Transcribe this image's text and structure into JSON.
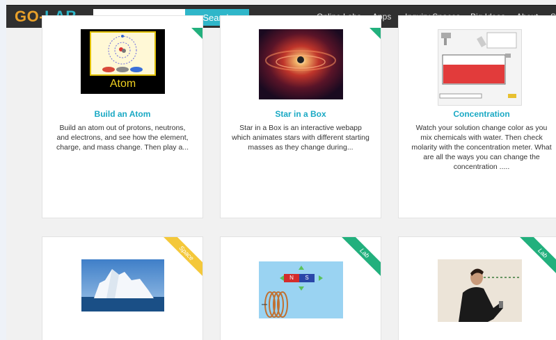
{
  "brand": {
    "go": "GO-",
    "lab": "LAB"
  },
  "search": {
    "placeholder": "",
    "button_label": "Search"
  },
  "nav": {
    "items": [
      "Online Labs",
      "Apps",
      "Inquiry Spaces",
      "Big Ideas",
      "About",
      "S"
    ]
  },
  "cards": [
    {
      "title": "Build an Atom",
      "description": "Build an atom out of protons, neutrons, and electrons, and see how the element, charge, and mass change. Then play a...",
      "thumb_label": "Atom"
    },
    {
      "title": "Star in a Box",
      "description": "Star in a Box is an interactive webapp which animates stars with different starting masses as they change during..."
    },
    {
      "title": "Concentration",
      "description": "Watch your solution change color as you mix chemicals with water. Then check molarity with the concentration meter. What are all the ways you can change the concentration ....."
    }
  ],
  "ribbons": {
    "space": "Space",
    "lab": "Lab"
  },
  "magnet": {
    "n": "N",
    "s": "S"
  },
  "colors": {
    "accent": "#2fb6c9",
    "navbar": "#303030",
    "space_ribbon": "#f4c83a",
    "lab_ribbon": "#22b07d"
  }
}
